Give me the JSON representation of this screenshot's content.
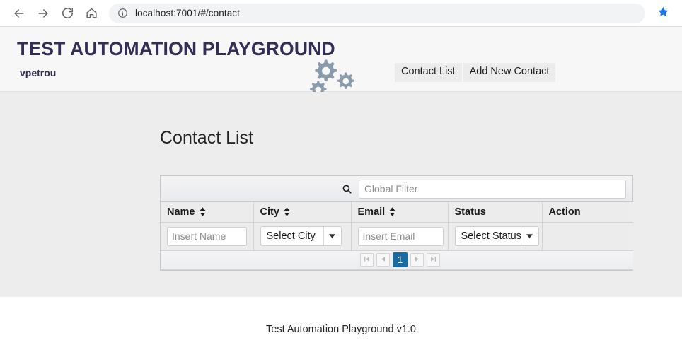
{
  "browser": {
    "back_icon": "arrow-left-icon",
    "forward_icon": "arrow-right-icon",
    "reload_icon": "reload-icon",
    "home_icon": "home-icon",
    "info_icon": "info-circle-icon",
    "url": "localhost:7001/#/contact",
    "bookmark_icon": "star-filled-icon"
  },
  "header": {
    "title": "TEST AUTOMATION PLAYGROUND",
    "subtitle": "vpetrou",
    "logo_icon": "gears-icon",
    "nav": [
      {
        "label": "Contact List"
      },
      {
        "label": "Add New Contact"
      }
    ]
  },
  "main": {
    "page_title": "Contact List",
    "search_icon": "search-icon",
    "global_filter": {
      "placeholder": "Global Filter",
      "value": ""
    },
    "columns": [
      {
        "label": "Name",
        "sortable": true,
        "sort_icon": "sort-updown-icon"
      },
      {
        "label": "City",
        "sortable": true,
        "sort_icon": "sort-updown-icon"
      },
      {
        "label": "Email",
        "sortable": true,
        "sort_icon": "sort-updown-icon"
      },
      {
        "label": "Status",
        "sortable": false
      },
      {
        "label": "Action",
        "sortable": false
      }
    ],
    "filters": {
      "name": {
        "placeholder": "Insert Name",
        "value": ""
      },
      "city": {
        "selected": "Select City",
        "arrow_icon": "caret-down-icon"
      },
      "email": {
        "placeholder": "Insert Email",
        "value": ""
      },
      "status": {
        "selected": "Select Status",
        "arrow_icon": "caret-down-icon"
      }
    },
    "pagination": {
      "first_icon": "page-first-icon",
      "prev_icon": "page-prev-icon",
      "current_page": "1",
      "next_icon": "page-next-icon",
      "last_icon": "page-last-icon"
    }
  },
  "footer": {
    "text": "Test Automation Playground v1.0"
  },
  "colors": {
    "brand": "#342d55",
    "accent": "#1a6ca0",
    "bookmark": "#1a73e8",
    "gear": "#8a9bab",
    "content_bg": "#ededed"
  }
}
